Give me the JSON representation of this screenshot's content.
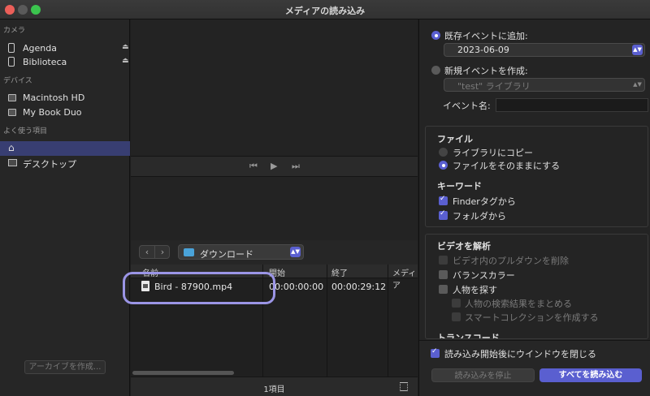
{
  "window": {
    "title": "メディアの読み込み"
  },
  "sidebar": {
    "camera_header": "カメラ",
    "devices_header": "デバイス",
    "favorites_header": "よく使う項目",
    "cameras": [
      {
        "label": "Agenda"
      },
      {
        "label": "Biblioteca"
      }
    ],
    "devices": [
      {
        "label": "Macintosh HD"
      },
      {
        "label": "My Book Duo"
      }
    ],
    "favorites": [
      {
        "label": ""
      },
      {
        "label": "デスクトップ"
      }
    ],
    "archive_button": "アーカイブを作成..."
  },
  "transport": {
    "prev": "⏮",
    "play": "▶",
    "next": "⏭"
  },
  "browser": {
    "folder": "ダウンロード",
    "columns": [
      "名前",
      "開始",
      "終了",
      "メディア"
    ],
    "rows": [
      {
        "name": "Bird - 87900.mp4",
        "start": "00:00:00:00",
        "end": "00:00:29:12"
      }
    ],
    "count": "1項目"
  },
  "right": {
    "add_existing_label": "既存イベントに追加:",
    "existing_event": "2023-06-09",
    "new_event_label": "新規イベントを作成:",
    "new_event_library": "\"test\" ライブラリ",
    "event_name_label": "イベント名:",
    "files_header": "ファイル",
    "copy_to_library": "ライブラリにコピー",
    "leave_in_place": "ファイルをそのままにする",
    "keywords_header": "キーワード",
    "finder_tags": "Finderタグから",
    "from_folders": "フォルダから",
    "analyze_header": "ビデオを解析",
    "remove_pulldown": "ビデオ内のプルダウンを削除",
    "balance_color": "バランスカラー",
    "find_people": "人物を探す",
    "consolidate_people": "人物の検索結果をまとめる",
    "smart_collections": "スマートコレクションを作成する",
    "transcode_header": "トランスコード",
    "close_after": "読み込み開始後にウインドウを閉じる",
    "stop_button": "読み込みを停止",
    "import_all_button": "すべてを読み込む"
  },
  "colors": {
    "accent": "#5a5fd0",
    "highlight": "#9b95e6"
  }
}
